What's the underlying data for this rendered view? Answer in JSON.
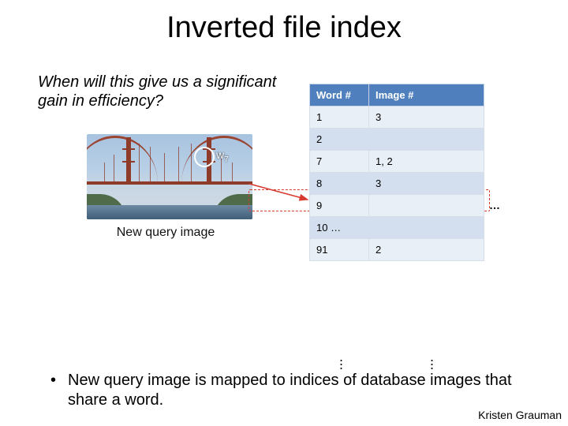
{
  "title": "Inverted file index",
  "question": "When will this give us a significant gain in efficiency?",
  "query_image": {
    "caption": "New query image",
    "feature_label_html": "w",
    "feature_subscript": "7"
  },
  "table": {
    "headers": [
      "Word #",
      "Image #"
    ],
    "rows": [
      {
        "word": "1",
        "images": "3"
      },
      {
        "word": "2",
        "images": ""
      },
      {
        "word": "7",
        "images": "1, 2"
      },
      {
        "word": "8",
        "images": "3"
      },
      {
        "word": "9",
        "images": ""
      },
      {
        "word": "10 …",
        "images": ""
      },
      {
        "word": "91",
        "images": "2"
      }
    ],
    "ellipsis_right": "…",
    "highlight_row_index": 2
  },
  "bullet": "New query image is mapped to indices of database images that share a word.",
  "author": "Kristen Grauman"
}
